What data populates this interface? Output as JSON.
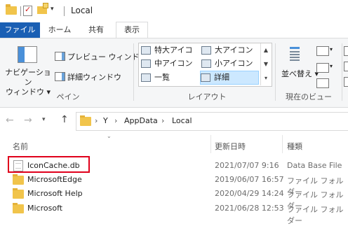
{
  "window": {
    "title": "Local"
  },
  "tabs": [
    {
      "label": "ファイル"
    },
    {
      "label": "ホーム"
    },
    {
      "label": "共有"
    },
    {
      "label": "表示"
    }
  ],
  "ribbon": {
    "pane": {
      "nav_pane_label_1": "ナビゲーション",
      "nav_pane_label_2": "ウィンドウ",
      "preview_pane": "プレビュー ウィンドウ",
      "details_pane": "詳細ウィンドウ",
      "group_label": "ペイン"
    },
    "layout": {
      "items": [
        {
          "label": "特大アイコン"
        },
        {
          "label": "大アイコン"
        },
        {
          "label": "中アイコン"
        },
        {
          "label": "小アイコン"
        },
        {
          "label": "一覧"
        },
        {
          "label": "詳細"
        }
      ],
      "group_label": "レイアウト"
    },
    "current_view": {
      "sort_label": "並べ替え",
      "group_label": "現在のビュー"
    }
  },
  "address": {
    "crumbs": [
      {
        "label": "Y"
      },
      {
        "label": "AppData"
      },
      {
        "label": "Local"
      }
    ]
  },
  "columns": {
    "name": "名前",
    "modified": "更新日時",
    "type": "種類"
  },
  "rows": [
    {
      "name": "IconCache.db",
      "modified": "2021/07/07 9:16",
      "type": "Data Base File",
      "icon": "file-icon"
    },
    {
      "name": "MicrosoftEdge",
      "modified": "2019/06/07 16:57",
      "type": "ファイル フォルダー",
      "icon": "folder-icon"
    },
    {
      "name": "Microsoft Help",
      "modified": "2020/04/29 14:24",
      "type": "ファイル フォルダー",
      "icon": "folder-icon"
    },
    {
      "name": "Microsoft",
      "modified": "2021/06/28 12:53",
      "type": "ファイル フォルダー",
      "icon": "folder-icon"
    }
  ],
  "colors": {
    "accent": "#1a5fb4",
    "highlight": "#e0001b",
    "folder": "#f1c44b"
  }
}
